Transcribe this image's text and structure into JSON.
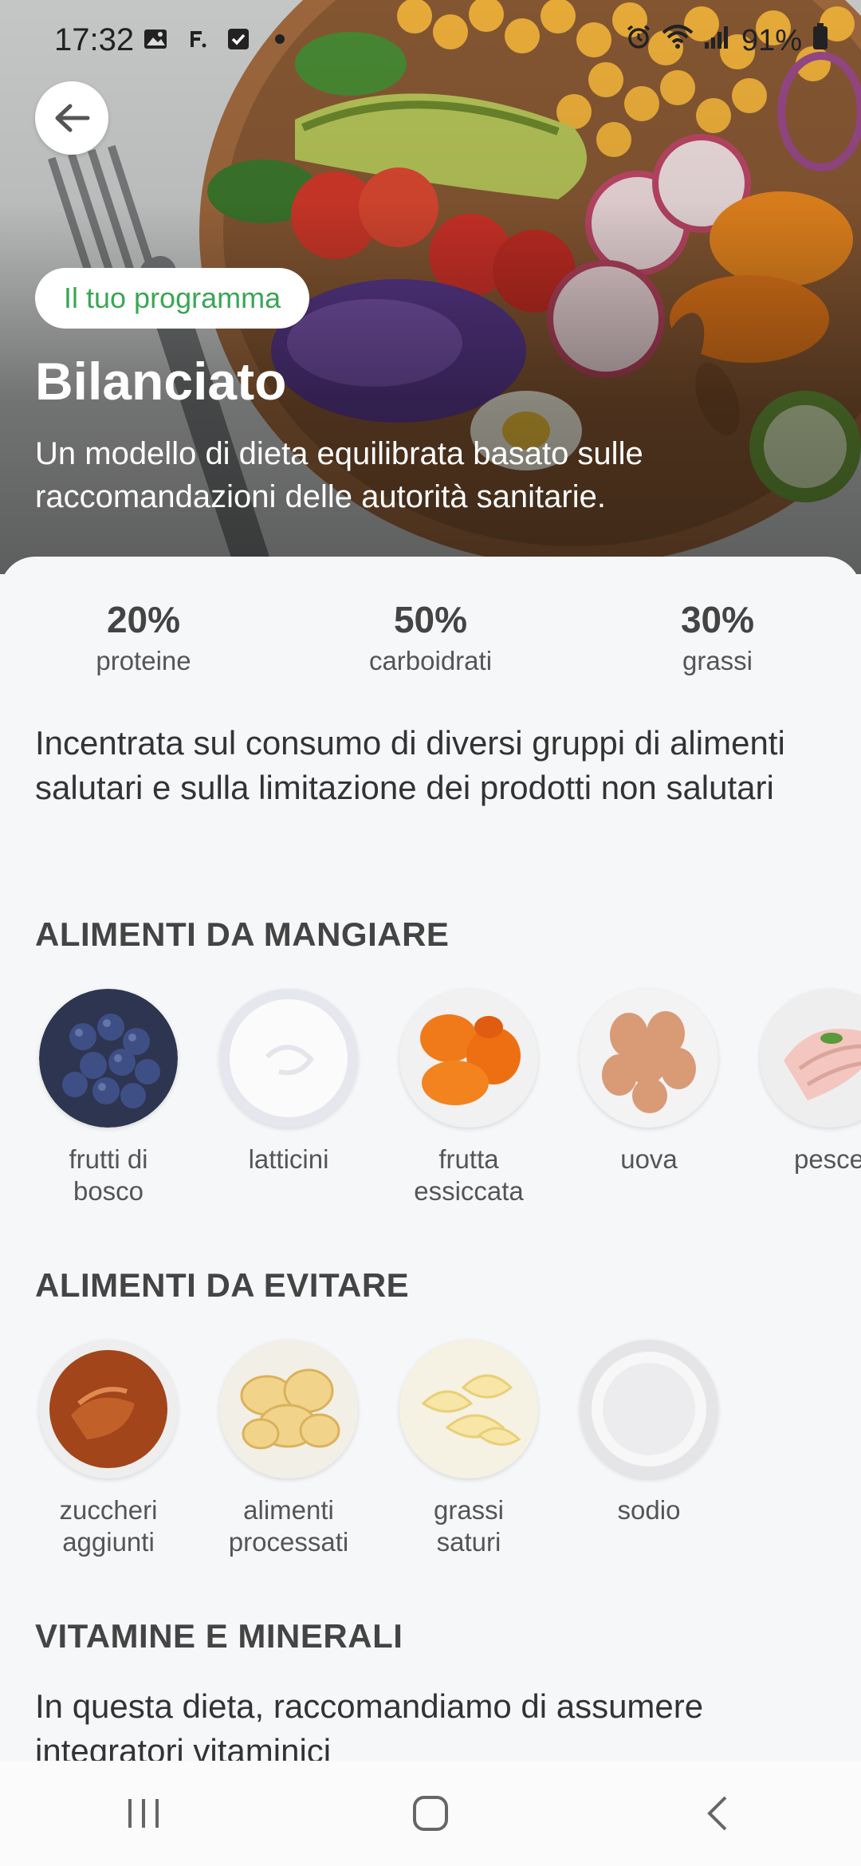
{
  "status_bar": {
    "time": "17:32",
    "battery": "91%"
  },
  "hero": {
    "badge": "Il tuo programma",
    "title": "Bilanciato",
    "description": "Un modello di dieta equilibrata basato sulle raccomandazioni delle autorità sanitarie."
  },
  "macros": [
    {
      "value": "20%",
      "label": "proteine"
    },
    {
      "value": "50%",
      "label": "carboidrati"
    },
    {
      "value": "30%",
      "label": "grassi"
    }
  ],
  "summary": "Incentrata sul consumo di diversi gruppi di alimenti salutari e sulla limitazione dei prodotti non salutari",
  "eat": {
    "title": "ALIMENTI DA MANGIARE",
    "items": [
      {
        "label": "frutti di\nbosco",
        "icon": "blueberries-image"
      },
      {
        "label": "latticini",
        "icon": "dairy-image"
      },
      {
        "label": "frutta\nessiccata",
        "icon": "dried-fruit-image"
      },
      {
        "label": "uova",
        "icon": "eggs-image"
      },
      {
        "label": "pesce",
        "icon": "fish-image"
      }
    ]
  },
  "avoid": {
    "title": "ALIMENTI DA EVITARE",
    "items": [
      {
        "label": "zuccheri\naggiunti",
        "icon": "caramel-image"
      },
      {
        "label": "alimenti\nprocessati",
        "icon": "chips-image"
      },
      {
        "label": "grassi\nsaturi",
        "icon": "butter-image"
      },
      {
        "label": "sodio",
        "icon": "salt-image"
      }
    ]
  },
  "vitamins": {
    "title": "VITAMINE E MINERALI",
    "text": "In questa dieta, raccomandiamo di assumere integratori vitaminici"
  },
  "colors": {
    "accent_green": "#3aa655",
    "sheet_bg": "#f6f7f9"
  }
}
